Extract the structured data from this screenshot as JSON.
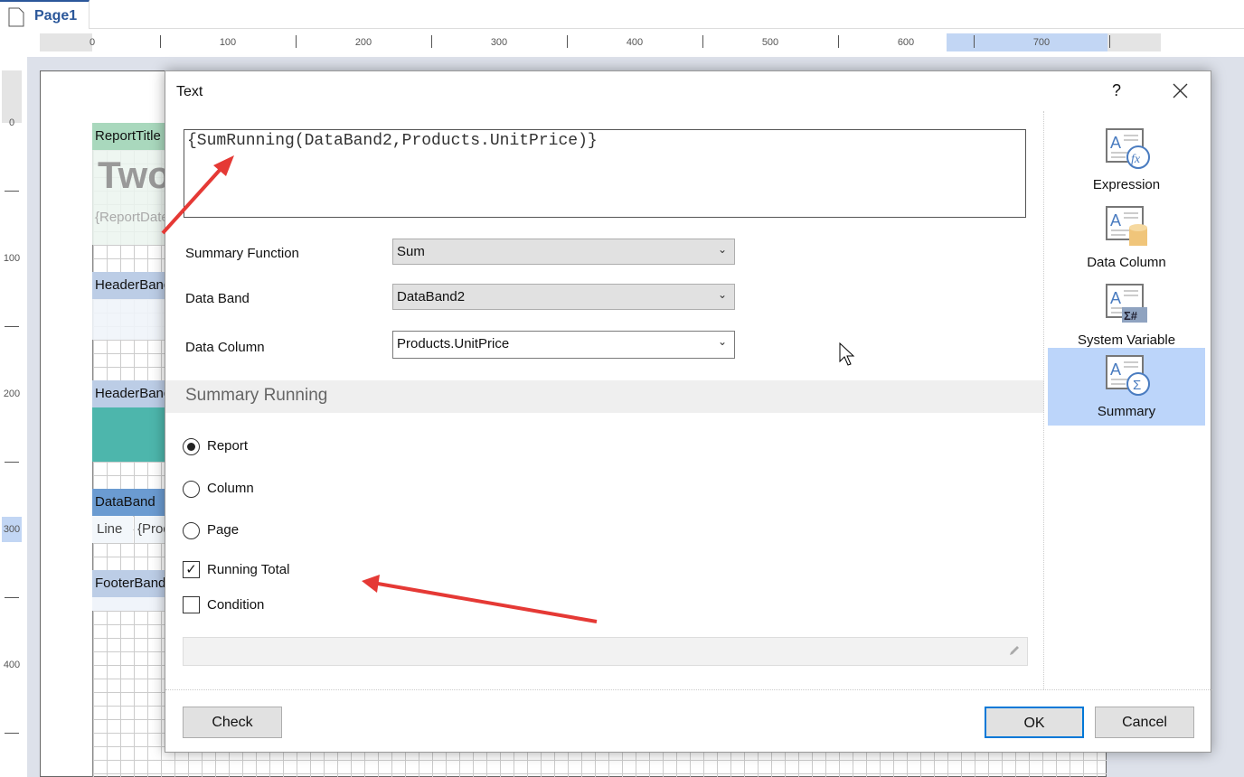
{
  "tab": {
    "label": "Page1"
  },
  "ruler": {
    "h": [
      "0",
      "100",
      "200",
      "300",
      "400",
      "500",
      "600",
      "700"
    ],
    "v": [
      "0",
      "100",
      "200",
      "300",
      "400"
    ]
  },
  "bands": {
    "report_title": "ReportTitle",
    "title_text": "Two",
    "report_date": "{ReportDate}",
    "header1": "HeaderBand",
    "header2": "HeaderBand",
    "databand": "DataBand",
    "line": "Line",
    "prod": "{Products",
    "footer": "FooterBand"
  },
  "dialog": {
    "title": "Text",
    "help": "?",
    "expression": "{SumRunning(DataBand2,Products.UnitPrice)}",
    "summary_function": {
      "label": "Summary Function",
      "value": "Sum"
    },
    "data_band": {
      "label": "Data Band",
      "value": "DataBand2"
    },
    "data_column": {
      "label": "Data Column",
      "value": "Products.UnitPrice"
    },
    "section": "Summary Running",
    "radios": [
      {
        "label": "Report",
        "checked": true
      },
      {
        "label": "Column",
        "checked": false
      },
      {
        "label": "Page",
        "checked": false
      }
    ],
    "running_total": {
      "label": "Running Total",
      "checked": true
    },
    "condition": {
      "label": "Condition",
      "checked": false,
      "value": ""
    },
    "buttons": {
      "check": "Check",
      "ok": "OK",
      "cancel": "Cancel"
    },
    "side": [
      {
        "label": "Expression",
        "icon": "expression-icon"
      },
      {
        "label": "Data Column",
        "icon": "data-column-icon"
      },
      {
        "label": "System Variable",
        "icon": "system-variable-icon"
      },
      {
        "label": "Summary",
        "icon": "summary-icon",
        "selected": true
      }
    ]
  },
  "colors": {
    "accent": "#2b579a",
    "selected": "#bcd5fa",
    "arrow": "#e53935"
  }
}
